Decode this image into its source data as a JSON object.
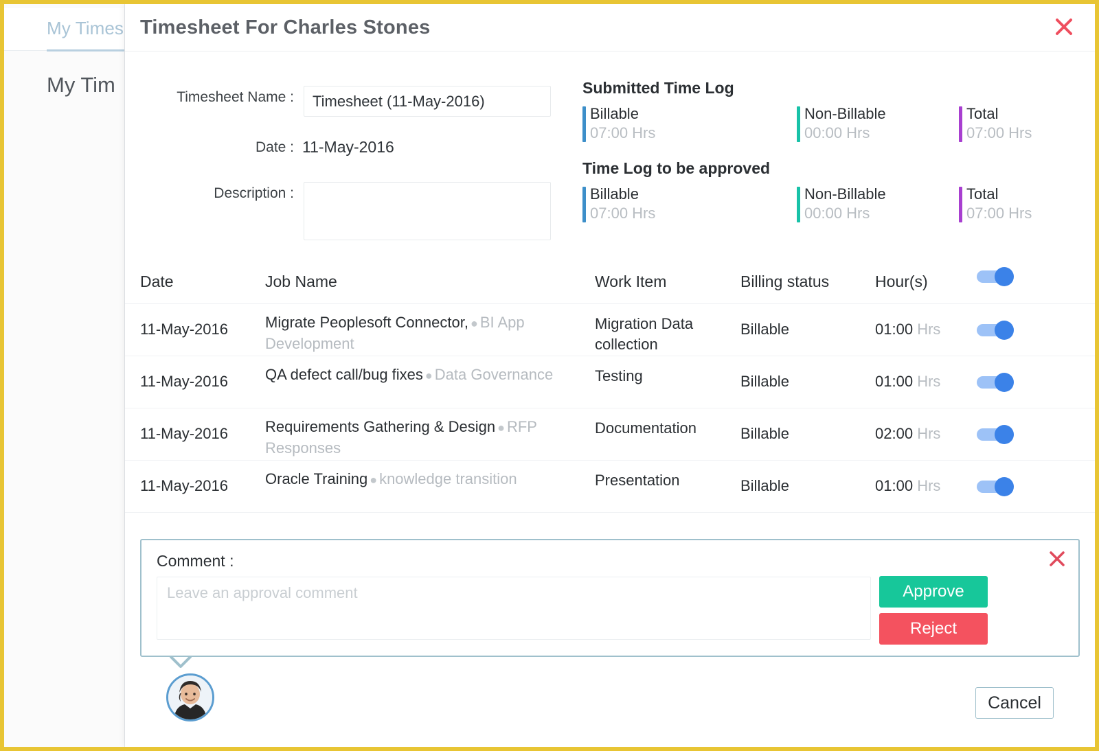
{
  "background": {
    "tab_label": "My Times",
    "heading": "My Tim",
    "footer_text": ""
  },
  "header": {
    "title": "Timesheet For Charles Stones",
    "close_icon": "close-icon",
    "close_color": "#ef4e5e"
  },
  "form": {
    "name_label": "Timesheet Name :",
    "name_value": "Timesheet (11-May-2016)",
    "date_label": "Date :",
    "date_value": "11-May-2016",
    "description_label": "Description :",
    "description_value": "",
    "description_placeholder": ""
  },
  "summary": {
    "groups": [
      {
        "heading": "Submitted Time Log",
        "items": [
          {
            "label": "Billable",
            "value": "07:00 Hrs",
            "color": "#3d8fc9"
          },
          {
            "label": "Non-Billable",
            "value": "00:00 Hrs",
            "color": "#18c2a8"
          },
          {
            "label": "Total",
            "value": "07:00 Hrs",
            "color": "#a83fd0"
          }
        ]
      },
      {
        "heading": "Time Log to be approved",
        "items": [
          {
            "label": "Billable",
            "value": "07:00 Hrs",
            "color": "#3d8fc9"
          },
          {
            "label": "Non-Billable",
            "value": "00:00 Hrs",
            "color": "#18c2a8"
          },
          {
            "label": "Total",
            "value": "07:00 Hrs",
            "color": "#a83fd0"
          }
        ]
      }
    ]
  },
  "table": {
    "columns": {
      "date": "Date",
      "job_name": "Job Name",
      "work_item": "Work Item",
      "billing_status": "Billing status",
      "hours": "Hour(s)"
    },
    "header_toggle_on": true,
    "rows": [
      {
        "date": "11-May-2016",
        "job_name": "Migrate Peoplesoft Connector,",
        "project": "BI App Development",
        "work_item": "Migration Data collection",
        "billing_status": "Billable",
        "hours": "01:00",
        "hours_unit": "Hrs",
        "toggle_on": true
      },
      {
        "date": "11-May-2016",
        "job_name": "QA defect call/bug fixes",
        "project": "Data Governance",
        "work_item": "Testing",
        "billing_status": "Billable",
        "hours": "01:00",
        "hours_unit": "Hrs",
        "toggle_on": true
      },
      {
        "date": "11-May-2016",
        "job_name": "Requirements Gathering & Design",
        "project": "RFP Responses",
        "work_item": "Documentation",
        "billing_status": "Billable",
        "hours": "02:00",
        "hours_unit": "Hrs",
        "toggle_on": true
      },
      {
        "date": "11-May-2016",
        "job_name": "Oracle Training",
        "project": "knowledge transition",
        "work_item": "Presentation",
        "billing_status": "Billable",
        "hours": "01:00",
        "hours_unit": "Hrs",
        "toggle_on": true
      }
    ]
  },
  "comment": {
    "label": "Comment :",
    "value": "",
    "placeholder": "Leave an approval comment",
    "approve_label": "Approve",
    "reject_label": "Reject",
    "approve_color": "#17c79a",
    "reject_color": "#f4525f",
    "close_icon": "close-icon"
  },
  "footer": {
    "cancel_label": "Cancel",
    "avatar_name": "avatar"
  },
  "colors": {
    "frame": "#e8c534",
    "toggle_track": "#9dc2f7",
    "toggle_knob": "#3b82e8",
    "panel_border": "#9fc0cc"
  }
}
